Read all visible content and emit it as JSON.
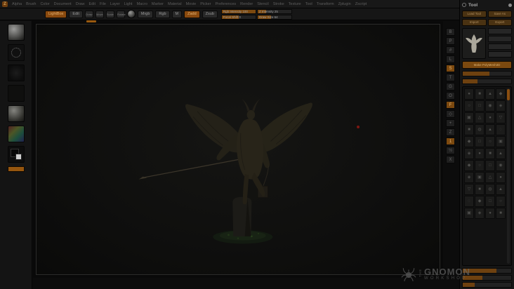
{
  "colors": {
    "accent": "#8a4a0e",
    "accent_bright": "#c87818",
    "panel": "#161616",
    "canvas": "#0e0e0d"
  },
  "menubar": {
    "logo": "Z",
    "items": [
      "Alpha",
      "Brush",
      "Color",
      "Document",
      "Draw",
      "Edit",
      "File",
      "Layer",
      "Light",
      "Macro",
      "Marker",
      "Material",
      "Movie",
      "Picker",
      "Preferences",
      "Render",
      "Stencil",
      "Stroke",
      "Texture",
      "Tool",
      "Transform",
      "Zplugin",
      "Zscript"
    ]
  },
  "top_shelf": {
    "lightbox_label": "LightBox",
    "edit_label": "Edit",
    "draw_label": "Draw",
    "move_label": "Move",
    "scale_label": "Scale",
    "rotate_label": "Rotate",
    "mrgb_label": "Mrgb",
    "rgb_label": "Rgb",
    "m_label": "M",
    "zadd_label": "Zadd",
    "zsub_label": "Zsub",
    "sliders": [
      {
        "label": "Rgb Intensity",
        "value": "100"
      },
      {
        "label": "Z Intensity",
        "value": "25"
      },
      {
        "label": "Focal Shift",
        "value": "0"
      },
      {
        "label": "Draw Size",
        "value": "64"
      }
    ]
  },
  "left_shelf": {
    "icons": [
      "brush-thumbnail",
      "stroke-thumbnail",
      "alpha-thumbnail",
      "texture-thumbnail",
      "material-thumbnail",
      "color-picker",
      "color-swatches",
      "switch-color-button"
    ]
  },
  "right_shelf": {
    "icons": [
      {
        "name": "bpr-render-icon",
        "glyph": "B",
        "active": false
      },
      {
        "name": "perspective-icon",
        "glyph": "P",
        "active": false
      },
      {
        "name": "floor-grid-icon",
        "glyph": "#",
        "active": false
      },
      {
        "name": "local-transform-icon",
        "glyph": "L",
        "active": false
      },
      {
        "name": "local-symmetry-icon",
        "glyph": "S",
        "active": true
      },
      {
        "name": "transparency-icon",
        "glyph": "T",
        "active": false
      },
      {
        "name": "ghost-icon",
        "glyph": "G",
        "active": false
      },
      {
        "name": "solo-icon",
        "glyph": "O",
        "active": false
      },
      {
        "name": "frame-icon",
        "glyph": "F",
        "active": true
      },
      {
        "name": "polyframe-icon",
        "glyph": "◇",
        "active": false
      },
      {
        "name": "scroll-canvas-icon",
        "glyph": "+",
        "active": false
      },
      {
        "name": "zoom-canvas-icon",
        "glyph": "Z",
        "active": false
      },
      {
        "name": "actual-size-icon",
        "glyph": "1",
        "active": true
      },
      {
        "name": "aa-half-icon",
        "glyph": "½",
        "active": false
      },
      {
        "name": "xyz-icon",
        "glyph": "X",
        "active": false
      }
    ]
  },
  "tool_panel": {
    "title": "Tool",
    "buttons": [
      "Load Tool",
      "Save As",
      "Import",
      "Export"
    ],
    "make_polymesh_label": "Make PolyMesh3D",
    "inventory_icons": [
      "●",
      "■",
      "▲",
      "◆",
      "○",
      "□",
      "◉",
      "◈",
      "▣",
      "△",
      "●",
      "▽",
      "■",
      "◍",
      "▲",
      "◌",
      "◆",
      "□",
      "○",
      "▣",
      "◈",
      "●",
      "■",
      "▲",
      "◆",
      "○",
      "□",
      "◉",
      "◈",
      "▣",
      "△",
      "●",
      "▽",
      "■",
      "◍",
      "▲",
      "◌",
      "◆",
      "□",
      "○",
      "▣",
      "◈",
      "●",
      "■"
    ]
  },
  "watermark": {
    "the": "THE",
    "gnomon": "GNOMON",
    "workshop": "WORKSHOP"
  }
}
